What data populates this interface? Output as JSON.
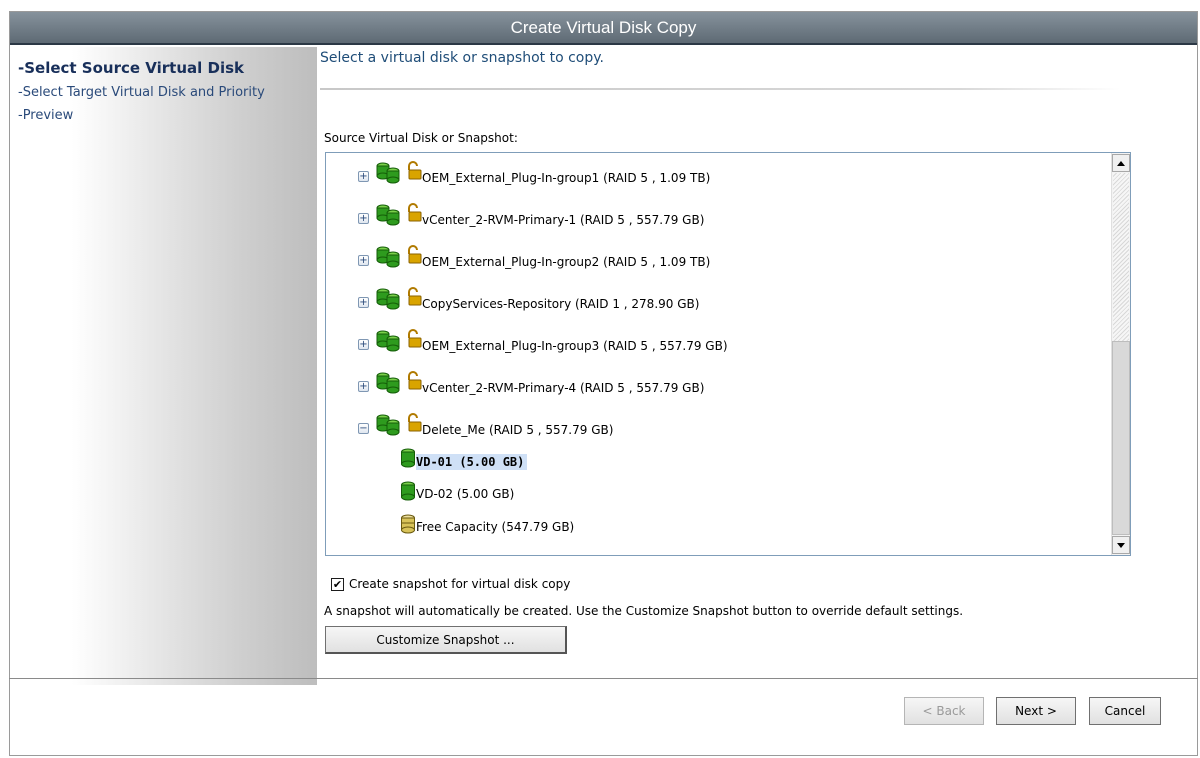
{
  "window": {
    "title": "Create Virtual Disk Copy"
  },
  "nav": {
    "steps": [
      {
        "label": "-Select Source Virtual Disk",
        "active": true
      },
      {
        "label": "-Select Target Virtual Disk and Priority",
        "active": false
      },
      {
        "label": "-Preview",
        "active": false
      }
    ]
  },
  "main": {
    "instruction": "Select a virtual disk or snapshot to copy.",
    "tree_label": "Source Virtual Disk or Snapshot:",
    "tree": {
      "items": [
        {
          "label": "OEM_External_Plug-In-group1 (RAID 5 , 1.09 TB)",
          "kind": "group",
          "expander": "+"
        },
        {
          "label": "vCenter_2-RVM-Primary-1 (RAID 5 , 557.79 GB)",
          "kind": "group",
          "expander": "+"
        },
        {
          "label": "OEM_External_Plug-In-group2 (RAID 5 , 1.09 TB)",
          "kind": "group",
          "expander": "+"
        },
        {
          "label": "CopyServices-Repository (RAID 1 , 278.90 GB)",
          "kind": "group",
          "expander": "+"
        },
        {
          "label": "OEM_External_Plug-In-group3 (RAID 5 , 557.79 GB)",
          "kind": "group",
          "expander": "+"
        },
        {
          "label": "vCenter_2-RVM-Primary-4 (RAID 5 , 557.79 GB)",
          "kind": "group",
          "expander": "+"
        },
        {
          "label": "Delete_Me (RAID 5 , 557.79 GB)",
          "kind": "group",
          "expander": "−"
        },
        {
          "label": "VD-01 (5.00 GB)",
          "kind": "disk",
          "selected": true
        },
        {
          "label": "VD-02 (5.00 GB)",
          "kind": "disk",
          "selected": false
        },
        {
          "label": "Free Capacity (547.79 GB)",
          "kind": "free",
          "selected": false
        }
      ]
    },
    "snapshot_checkbox": {
      "label": "Create snapshot for virtual disk copy",
      "checked": true
    },
    "snapshot_info": "A snapshot will automatically be created. Use the Customize Snapshot button to override default settings.",
    "customize_button": "Customize Snapshot ..."
  },
  "footer": {
    "back": "< Back",
    "next": "Next >",
    "cancel": "Cancel"
  },
  "colors": {
    "title_bar": "#6f7b86",
    "nav_active": "#182f5a",
    "selection": "#cfe0f6",
    "disk_green": "#2e9b1e",
    "lock_gold": "#d9a400"
  }
}
